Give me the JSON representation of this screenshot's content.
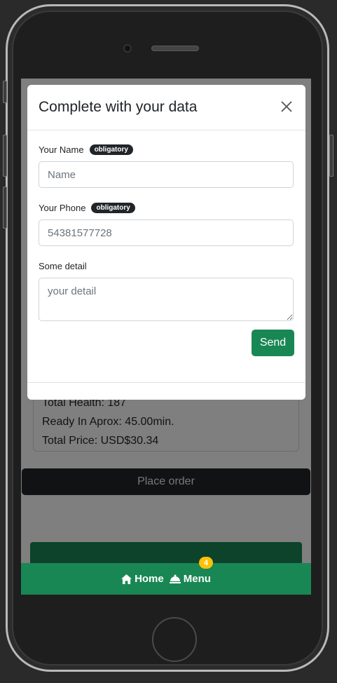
{
  "modal": {
    "title": "Complete with your data",
    "fields": {
      "name": {
        "label": "Your Name",
        "tag": "obligatory",
        "placeholder": "Name"
      },
      "phone": {
        "label": "Your Phone",
        "tag": "obligatory",
        "placeholder": "54381577728"
      },
      "detail": {
        "label": "Some detail",
        "placeholder": "your detail"
      }
    },
    "send_label": "Send"
  },
  "order": {
    "total_health": "Total Health: 187",
    "ready_in": "Ready In Aprox: 45.00min.",
    "total_price": "Total Price: USD$30.34",
    "place_order_label": "Place order"
  },
  "nav": {
    "home_label": "Home",
    "menu_label": "Menu",
    "cart_count": "4"
  },
  "colors": {
    "primary_green": "#198754",
    "dark": "#212529",
    "badge_yellow": "#ffc107"
  }
}
